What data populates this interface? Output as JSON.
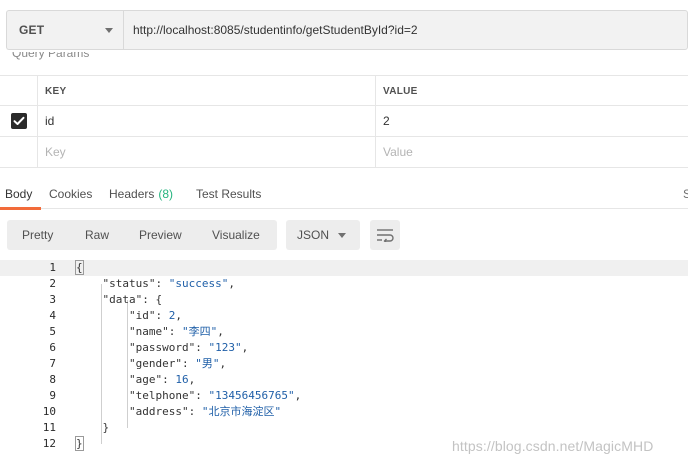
{
  "request": {
    "method": "GET",
    "url": "http://localhost:8085/studentinfo/getStudentById?id=2"
  },
  "query_params": {
    "label": "Query Params",
    "headers": [
      "KEY",
      "VALUE"
    ],
    "rows": [
      {
        "checked": true,
        "key": "id",
        "value": "2"
      }
    ],
    "key_placeholder": "Key",
    "value_placeholder": "Value"
  },
  "tabs": {
    "body": "Body",
    "cookies": "Cookies",
    "headers": "Headers",
    "headers_count": "(8)",
    "test_results": "Test Results",
    "edge_glyph": "S"
  },
  "response_view": {
    "pretty": "Pretty",
    "raw": "Raw",
    "preview": "Preview",
    "visualize": "Visualize",
    "format": "JSON"
  },
  "response_body": {
    "line_numbers": [
      "1",
      "2",
      "3",
      "4",
      "5",
      "6",
      "7",
      "8",
      "9",
      "10",
      "11",
      "12"
    ],
    "open_brace": "{",
    "status_key": "\"status\"",
    "status_value": "\"success\"",
    "data_key": "\"data\"",
    "id_key": "\"id\"",
    "id_value": "2",
    "name_key": "\"name\"",
    "name_value": "\"李四\"",
    "password_key": "\"password\"",
    "password_value": "\"123\"",
    "gender_key": "\"gender\"",
    "gender_value": "\"男\"",
    "age_key": "\"age\"",
    "age_value": "16",
    "telphone_key": "\"telphone\"",
    "telphone_value": "\"13456456765\"",
    "address_key": "\"address\"",
    "address_value": "\"北京市海淀区\"",
    "close_inner": "}",
    "close_brace": "}"
  },
  "watermark": "https://blog.csdn.net/MagicMHD",
  "icons": {
    "method_dropdown": "caret-down-icon",
    "checkbox": "check-icon",
    "format_dropdown": "caret-down-icon",
    "wrap": "wrap-lines-icon"
  }
}
